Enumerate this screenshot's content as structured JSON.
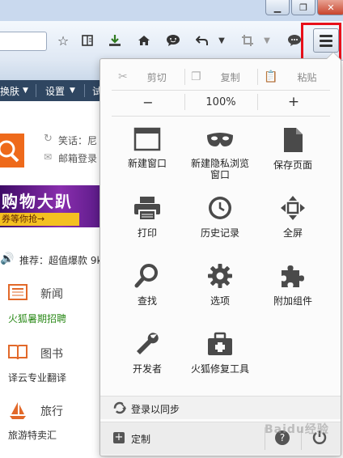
{
  "panel": {
    "edit": {
      "cut": "剪切",
      "copy": "复制",
      "paste": "粘贴"
    },
    "zoom": {
      "minus": "−",
      "level": "100%",
      "plus": "+"
    },
    "items": [
      {
        "label": "新建窗口",
        "icon": "window-icon"
      },
      {
        "label": "新建隐私浏览窗口",
        "icon": "mask-icon"
      },
      {
        "label": "保存页面",
        "icon": "page-icon"
      },
      {
        "label": "打印",
        "icon": "printer-icon"
      },
      {
        "label": "历史记录",
        "icon": "clock-icon"
      },
      {
        "label": "全屏",
        "icon": "fullscreen-icon"
      },
      {
        "label": "查找",
        "icon": "magnifier-icon"
      },
      {
        "label": "选项",
        "icon": "gear-icon"
      },
      {
        "label": "附加组件",
        "icon": "puzzle-icon"
      },
      {
        "label": "开发者",
        "icon": "wrench-icon"
      },
      {
        "label": "火狐修复工具",
        "icon": "toolbox-icon"
      }
    ],
    "sync": "登录以同步",
    "customize": "定制"
  },
  "bookmarks": {
    "b1": "换肤",
    "b2": "设置",
    "b3": "试"
  },
  "page": {
    "greeting": "笑话：尼",
    "mail": "邮箱登录",
    "promo_title": "购物大趴",
    "promo_sub": "券等你抢→",
    "recommend": "推荐：超值爆款 9k",
    "cat1": "新闻",
    "sub1": "火狐暑期招聘",
    "cat2": "图书",
    "sub2": "译云专业翻译",
    "cat3": "旅行",
    "sub3": "旅游特卖汇"
  },
  "watermark": "Baidu经验",
  "colors": {
    "accent": "#ee6a1b",
    "highlight": "#e8101a",
    "icon": "#4a4a4a",
    "bookmark_bar": "#2f4661"
  }
}
